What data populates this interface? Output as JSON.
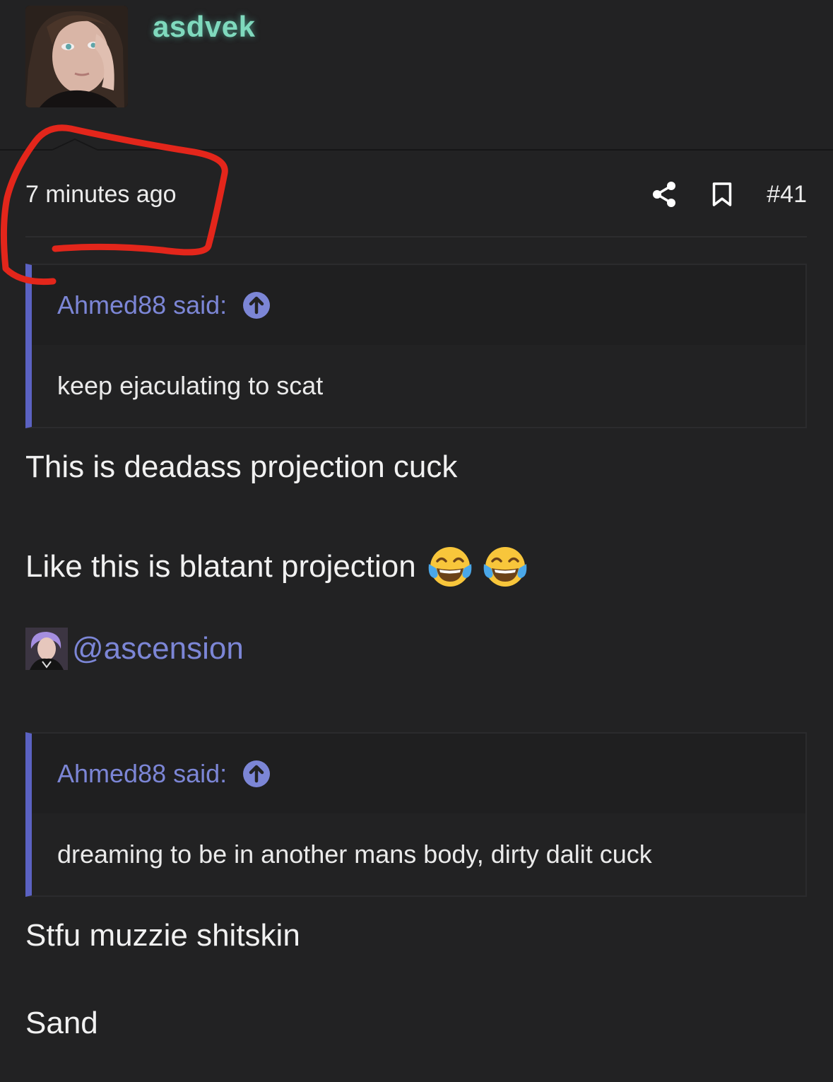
{
  "user": {
    "username": "asdvek",
    "avatar_alt": "user-avatar"
  },
  "post": {
    "timestamp": "7 minutes ago",
    "post_number": "#41",
    "actions": [
      {
        "icon": "share-icon"
      },
      {
        "icon": "bookmark-icon"
      }
    ]
  },
  "quotes": [
    {
      "author": "Ahmed88 said:",
      "text": "keep ejaculating to scat"
    },
    {
      "author": "Ahmed88 said:",
      "text": "dreaming to be in another mans body, dirty dalit cuck"
    }
  ],
  "body": {
    "line1": "This is deadass projection cuck",
    "line2": "Like this is blatant projection",
    "line2_emoji": [
      "face-with-tears-of-joy",
      "face-with-tears-of-joy"
    ],
    "mention": "@ascension",
    "line3": "Stfu muzzie shitskin",
    "line4": "Sand"
  },
  "colors": {
    "background": "#222223",
    "username": "#7fd9bd",
    "link": "#7c86d6",
    "quote_accent": "#5b62c2",
    "annotation": "#e3261b"
  }
}
